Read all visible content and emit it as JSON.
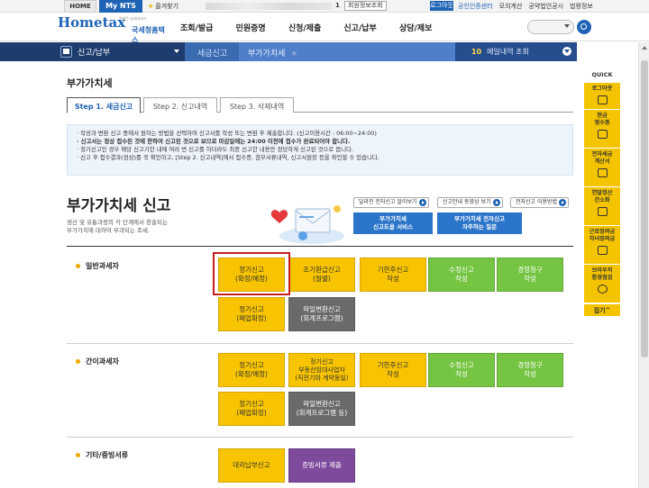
{
  "util": {
    "home": "HOME",
    "mynts": "My NTS",
    "favorites": "즐겨찾기",
    "separator": "1",
    "member_info": "회원정보조회",
    "logout": "로그아웃",
    "links": [
      "공인인증센터",
      "모의계산",
      "공약법인공시",
      "법령정보"
    ]
  },
  "header": {
    "logo": "Hometax",
    "logo_sub": "국세청홈택스",
    "logo_tagline": "언제든 납세서비스",
    "nav": [
      "조회/발급",
      "민원증명",
      "신청/제출",
      "신고/납부",
      "상담/제보"
    ]
  },
  "navbar": {
    "breadcrumb1": "신고/납부",
    "breadcrumb2": "세금신고",
    "breadcrumb3": "부가가치세",
    "recent_count": "10",
    "recent_label": "메일내역 조회"
  },
  "page": {
    "title": "부가가치세",
    "tabs": [
      "Step 1. 세금신고",
      "Step 2. 신고내역",
      "Step 3. 삭제내역"
    ],
    "notice": [
      "· 작성과 변환 신고 중에서 원하는 방법을 선택하여 신고서를 작성 또는 변환 후 제출합니다. (신고이용시간 : 06:00~24:00)",
      "· 신고서는 정상 접수된 것에 한하여 신고된 것으로 보므로 마감일에는 24:00 이전에 접수가 완료되어야 합니다.",
      "· 정기신고인 경우 해당 신고기한 내에 여러 번 신고를 하더라도 최종 신고한 내용만 정당하게 신고된 것으로 봅니다.",
      "· 신고 후 접수결과(정상)를 꼭 확인하고, [Step 2. 신고내역]에서 접수증, 첨부서류내역, 신고서원장 등을 확인할 수 있습니다."
    ],
    "heading": "부가가치세 신고",
    "desc1": "생산 및 유통과정의 각 단계에서 창출되는",
    "desc2": "부가가치에 대하여 부과되는 조세.",
    "guide_buttons": [
      "달라진 전자신고 알아보기",
      "신고안내 동영상 보기",
      "전자신고 이용방법"
    ],
    "blue_buttons": [
      {
        "l1": "부가가치세",
        "l2": "신고도움 서비스"
      },
      {
        "l1": "부가가치세 전자신고",
        "l2": "자주하는 질문"
      }
    ]
  },
  "sections": [
    {
      "title": "일반과세자",
      "buttons": [
        {
          "l1": "정기신고",
          "l2": "(확정/예정)"
        },
        {
          "l1": "조기환급신고",
          "l2": "(월별)"
        },
        {
          "l1": "기한후신고",
          "l2": "작성"
        },
        {
          "l1": "수정신고",
          "l2": "작성"
        },
        {
          "l1": "경정청구",
          "l2": "작성"
        },
        {
          "l1": "정기신고",
          "l2": "(폐업확정)"
        },
        {
          "l1": "파일변환신고",
          "l2": "(회계프로그램)"
        }
      ]
    },
    {
      "title": "간이과세자",
      "buttons": [
        {
          "l1": "정기신고",
          "l2": "(확정/예정)"
        },
        {
          "l1": "정기신고",
          "l2": "부동산임대사업자",
          "l3": "(직전기와 계약동일)"
        },
        {
          "l1": "기한후신고",
          "l2": "작성"
        },
        {
          "l1": "수정신고",
          "l2": "작성"
        },
        {
          "l1": "경정청구",
          "l2": "작성"
        },
        {
          "l1": "정기신고",
          "l2": "(폐업확정)"
        },
        {
          "l1": "파일변환신고",
          "l2": "(회계프로그램 등)"
        }
      ]
    },
    {
      "title": "기타/증빙서류",
      "buttons": [
        {
          "l1": "대리납부신고"
        },
        {
          "l1": "증빙서류 제출"
        }
      ]
    }
  ],
  "quick": {
    "head": "QUICK",
    "items": [
      {
        "l1": "로그아웃"
      },
      {
        "l1": "현금",
        "l2": "영수증"
      },
      {
        "l1": "전자세금",
        "l2": "계산서"
      },
      {
        "l1": "연말정산",
        "l2": "간소화"
      },
      {
        "l1": "근로장려금",
        "l2": "자녀장려금"
      },
      {
        "l1": "브라우저",
        "l2": "환경점검"
      }
    ],
    "close": "접기^"
  }
}
